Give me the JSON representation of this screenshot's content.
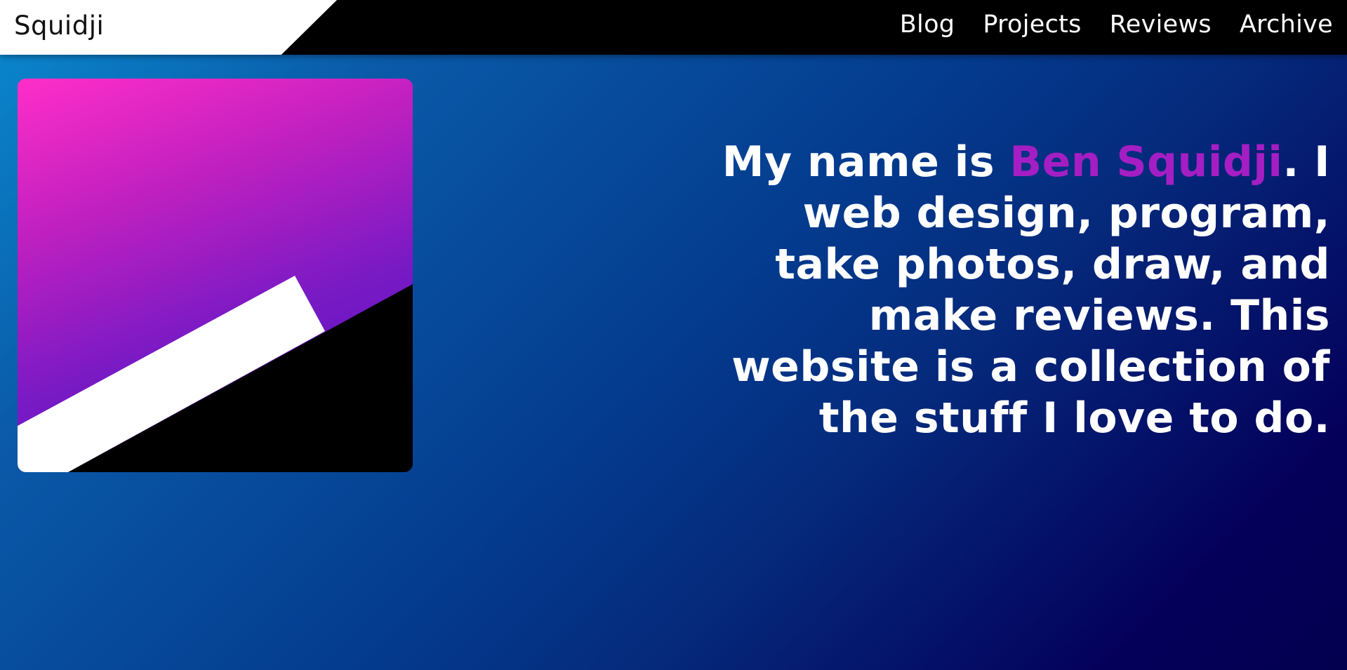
{
  "header": {
    "logo": "Squidji",
    "nav": [
      "Blog",
      "Projects",
      "Reviews",
      "Archive"
    ]
  },
  "intro": {
    "prefix": "My name is ",
    "name": "Ben Squidji",
    "suffix": ". I web design, program, take photos, draw, and make reviews. This website is a collection of the stuff I love to do."
  },
  "colors": {
    "accent_name": "#a51ec4",
    "topbar": "#000000",
    "logo_tab": "#ffffff"
  },
  "icons": {
    "avatar": "squidji-logo-graphic"
  }
}
